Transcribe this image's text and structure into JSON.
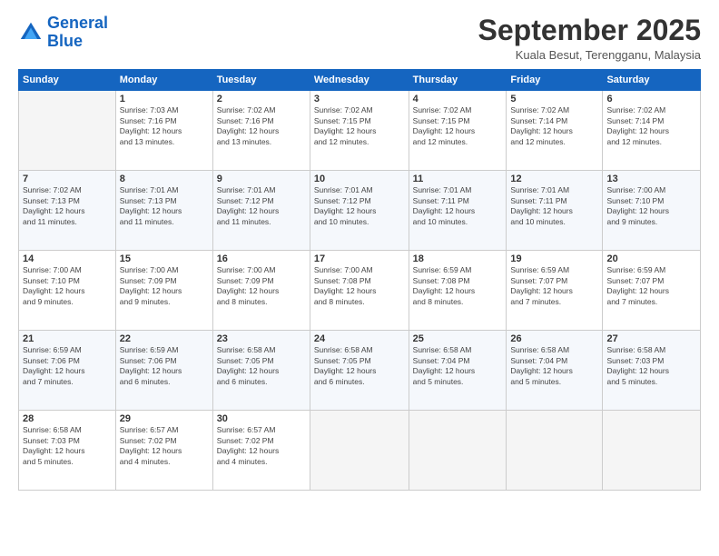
{
  "logo": {
    "line1": "General",
    "line2": "Blue"
  },
  "header": {
    "month": "September 2025",
    "location": "Kuala Besut, Terengganu, Malaysia"
  },
  "weekdays": [
    "Sunday",
    "Monday",
    "Tuesday",
    "Wednesday",
    "Thursday",
    "Friday",
    "Saturday"
  ],
  "weeks": [
    [
      {
        "day": "",
        "info": ""
      },
      {
        "day": "1",
        "info": "Sunrise: 7:03 AM\nSunset: 7:16 PM\nDaylight: 12 hours\nand 13 minutes."
      },
      {
        "day": "2",
        "info": "Sunrise: 7:02 AM\nSunset: 7:16 PM\nDaylight: 12 hours\nand 13 minutes."
      },
      {
        "day": "3",
        "info": "Sunrise: 7:02 AM\nSunset: 7:15 PM\nDaylight: 12 hours\nand 12 minutes."
      },
      {
        "day": "4",
        "info": "Sunrise: 7:02 AM\nSunset: 7:15 PM\nDaylight: 12 hours\nand 12 minutes."
      },
      {
        "day": "5",
        "info": "Sunrise: 7:02 AM\nSunset: 7:14 PM\nDaylight: 12 hours\nand 12 minutes."
      },
      {
        "day": "6",
        "info": "Sunrise: 7:02 AM\nSunset: 7:14 PM\nDaylight: 12 hours\nand 12 minutes."
      }
    ],
    [
      {
        "day": "7",
        "info": "Sunrise: 7:02 AM\nSunset: 7:13 PM\nDaylight: 12 hours\nand 11 minutes."
      },
      {
        "day": "8",
        "info": "Sunrise: 7:01 AM\nSunset: 7:13 PM\nDaylight: 12 hours\nand 11 minutes."
      },
      {
        "day": "9",
        "info": "Sunrise: 7:01 AM\nSunset: 7:12 PM\nDaylight: 12 hours\nand 11 minutes."
      },
      {
        "day": "10",
        "info": "Sunrise: 7:01 AM\nSunset: 7:12 PM\nDaylight: 12 hours\nand 10 minutes."
      },
      {
        "day": "11",
        "info": "Sunrise: 7:01 AM\nSunset: 7:11 PM\nDaylight: 12 hours\nand 10 minutes."
      },
      {
        "day": "12",
        "info": "Sunrise: 7:01 AM\nSunset: 7:11 PM\nDaylight: 12 hours\nand 10 minutes."
      },
      {
        "day": "13",
        "info": "Sunrise: 7:00 AM\nSunset: 7:10 PM\nDaylight: 12 hours\nand 9 minutes."
      }
    ],
    [
      {
        "day": "14",
        "info": "Sunrise: 7:00 AM\nSunset: 7:10 PM\nDaylight: 12 hours\nand 9 minutes."
      },
      {
        "day": "15",
        "info": "Sunrise: 7:00 AM\nSunset: 7:09 PM\nDaylight: 12 hours\nand 9 minutes."
      },
      {
        "day": "16",
        "info": "Sunrise: 7:00 AM\nSunset: 7:09 PM\nDaylight: 12 hours\nand 8 minutes."
      },
      {
        "day": "17",
        "info": "Sunrise: 7:00 AM\nSunset: 7:08 PM\nDaylight: 12 hours\nand 8 minutes."
      },
      {
        "day": "18",
        "info": "Sunrise: 6:59 AM\nSunset: 7:08 PM\nDaylight: 12 hours\nand 8 minutes."
      },
      {
        "day": "19",
        "info": "Sunrise: 6:59 AM\nSunset: 7:07 PM\nDaylight: 12 hours\nand 7 minutes."
      },
      {
        "day": "20",
        "info": "Sunrise: 6:59 AM\nSunset: 7:07 PM\nDaylight: 12 hours\nand 7 minutes."
      }
    ],
    [
      {
        "day": "21",
        "info": "Sunrise: 6:59 AM\nSunset: 7:06 PM\nDaylight: 12 hours\nand 7 minutes."
      },
      {
        "day": "22",
        "info": "Sunrise: 6:59 AM\nSunset: 7:06 PM\nDaylight: 12 hours\nand 6 minutes."
      },
      {
        "day": "23",
        "info": "Sunrise: 6:58 AM\nSunset: 7:05 PM\nDaylight: 12 hours\nand 6 minutes."
      },
      {
        "day": "24",
        "info": "Sunrise: 6:58 AM\nSunset: 7:05 PM\nDaylight: 12 hours\nand 6 minutes."
      },
      {
        "day": "25",
        "info": "Sunrise: 6:58 AM\nSunset: 7:04 PM\nDaylight: 12 hours\nand 5 minutes."
      },
      {
        "day": "26",
        "info": "Sunrise: 6:58 AM\nSunset: 7:04 PM\nDaylight: 12 hours\nand 5 minutes."
      },
      {
        "day": "27",
        "info": "Sunrise: 6:58 AM\nSunset: 7:03 PM\nDaylight: 12 hours\nand 5 minutes."
      }
    ],
    [
      {
        "day": "28",
        "info": "Sunrise: 6:58 AM\nSunset: 7:03 PM\nDaylight: 12 hours\nand 5 minutes."
      },
      {
        "day": "29",
        "info": "Sunrise: 6:57 AM\nSunset: 7:02 PM\nDaylight: 12 hours\nand 4 minutes."
      },
      {
        "day": "30",
        "info": "Sunrise: 6:57 AM\nSunset: 7:02 PM\nDaylight: 12 hours\nand 4 minutes."
      },
      {
        "day": "",
        "info": ""
      },
      {
        "day": "",
        "info": ""
      },
      {
        "day": "",
        "info": ""
      },
      {
        "day": "",
        "info": ""
      }
    ]
  ]
}
